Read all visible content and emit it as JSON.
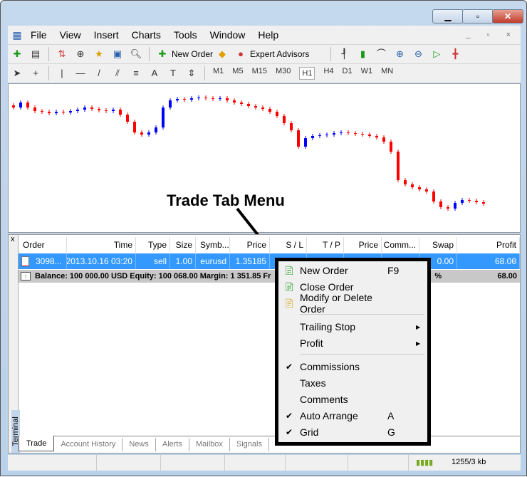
{
  "window": {
    "buttons": [
      "minimize",
      "maximize",
      "close"
    ]
  },
  "menubar": [
    "File",
    "View",
    "Insert",
    "Charts",
    "Tools",
    "Window",
    "Help"
  ],
  "toolbar": {
    "new_order": "New Order",
    "expert_advisors": "Expert Advisors",
    "timeframes": [
      "M1",
      "M5",
      "M15",
      "M30",
      "H1",
      "H4",
      "D1",
      "W1",
      "MN"
    ],
    "active_timeframe": "H1"
  },
  "chart": {
    "type": "candlestick",
    "up_color": "#0000ff",
    "down_color": "#ff0000",
    "closes": [
      250,
      257,
      250,
      245,
      244,
      242,
      244,
      243,
      245,
      247,
      250,
      248,
      246,
      245,
      247,
      240,
      230,
      215,
      212,
      215,
      222,
      250,
      260,
      262,
      261,
      263,
      264,
      263,
      262,
      263,
      260,
      257,
      255,
      252,
      250,
      248,
      244,
      238,
      228,
      218,
      195,
      207,
      210,
      211,
      212,
      214,
      215,
      214,
      213,
      212,
      210,
      208,
      202,
      188,
      148,
      142,
      138,
      135,
      132,
      118,
      110,
      108,
      116,
      120,
      119,
      117,
      115
    ]
  },
  "callout": "Trade Tab Menu",
  "terminal": {
    "label": "Terminal",
    "columns": [
      "Order",
      "Time",
      "Type",
      "Size",
      "Symb...",
      "Price",
      "S / L",
      "T / P",
      "Price",
      "Comm...",
      "Swap",
      "Profit"
    ],
    "row": [
      "3098...",
      "2013.10.16 03:20",
      "sell",
      "1.00",
      "eurusd",
      "1.35185",
      "",
      "",
      "",
      "",
      "0.00",
      "68.00"
    ],
    "balance": "Balance: 100 000.00 USD  Equity: 100 068.00  Margin: 1 351.85  Fr",
    "balance_tail": "%",
    "balance_profit": "68.00",
    "tabs": [
      "Trade",
      "Account History",
      "News",
      "Alerts",
      "Mailbox",
      "Signals"
    ]
  },
  "context_menu": {
    "items": [
      {
        "label": "New Order",
        "shortcut": "F9",
        "icon": "new-order-icon"
      },
      {
        "label": "Close Order",
        "icon": "close-order-icon"
      },
      {
        "label": "Modify or Delete Order",
        "icon": "modify-order-icon"
      },
      {
        "label": "Trailing Stop",
        "submenu": true
      },
      {
        "label": "Profit",
        "submenu": true
      },
      {
        "label": "Commissions",
        "checked": true
      },
      {
        "label": "Taxes"
      },
      {
        "label": "Comments"
      },
      {
        "label": "Auto Arrange",
        "shortcut": "A",
        "checked": true
      },
      {
        "label": "Grid",
        "shortcut": "G",
        "checked": true
      }
    ]
  },
  "status": {
    "traffic": "1255/3 kb"
  }
}
